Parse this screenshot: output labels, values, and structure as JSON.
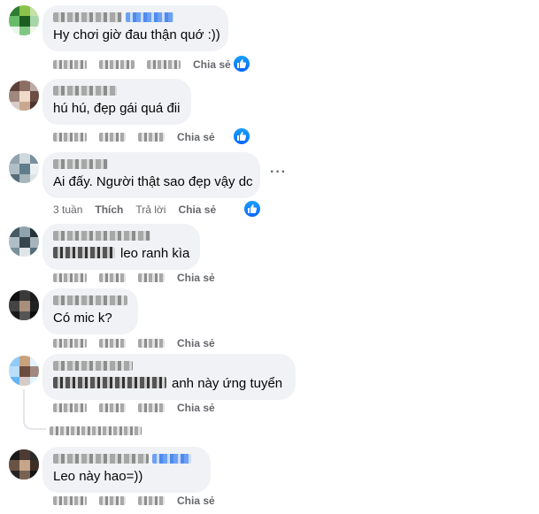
{
  "comments": [
    {
      "text": "Hy chơi giờ đau thận quớ :))",
      "share_label": "Chia sẻ"
    },
    {
      "text": "hú hú, đẹp gái quá đii",
      "share_label": "Chia sẻ"
    },
    {
      "text": "Ai đấy. Người thật sao đẹp vậy dc",
      "time": "3 tuần",
      "like_label": "Thích",
      "reply_label": "Trả lời",
      "share_label": "Chia sẻ",
      "more": "···"
    },
    {
      "text": "leo ranh kìa",
      "share_label": "Chia sẻ"
    },
    {
      "text": "Có mic k?",
      "share_label": "Chia sẻ"
    },
    {
      "text": "anh này ứng tuyển",
      "share_label": "Chia sẻ"
    },
    {
      "text": "Leo này hao=))",
      "share_label": "Chia sẻ"
    }
  ],
  "colors": {
    "bubble": "#f0f2f5",
    "meta_text": "#65676b",
    "like_blue": "#0866ff"
  },
  "icons": {
    "like": "thumbs-up-icon",
    "more": "more-options-icon"
  }
}
